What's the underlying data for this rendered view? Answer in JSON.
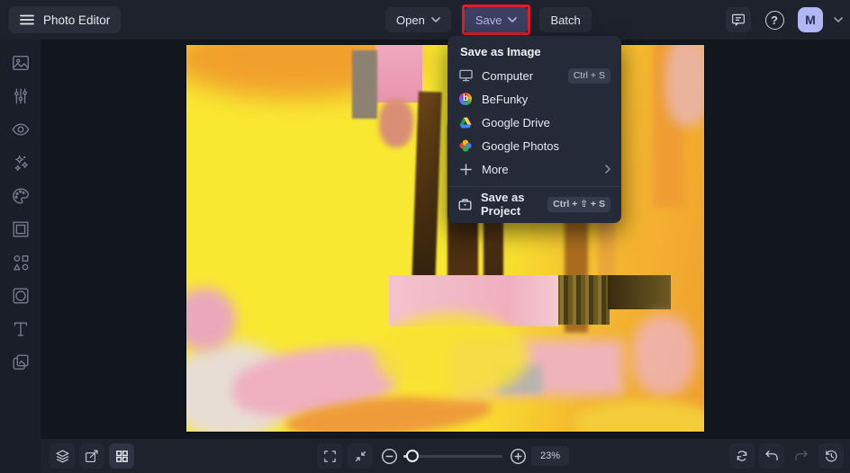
{
  "app": {
    "title": "Photo Editor"
  },
  "topbar": {
    "open": "Open",
    "save": "Save",
    "batch": "Batch",
    "help_glyph": "?",
    "avatar_initial": "M"
  },
  "save_menu": {
    "header": "Save as Image",
    "items": [
      {
        "label": "Computer",
        "shortcut": "Ctrl + S"
      },
      {
        "label": "BeFunky",
        "logo_letter": "b"
      },
      {
        "label": "Google Drive"
      },
      {
        "label": "Google Photos"
      },
      {
        "label": "More",
        "has_submenu": true
      }
    ],
    "project_item": {
      "label": "Save as Project",
      "shortcut": "Ctrl + ⇧ + S"
    }
  },
  "sidebar": {
    "tools": [
      "edit",
      "adjust",
      "touch-up",
      "effects",
      "artsy",
      "frames",
      "graphics",
      "overlays",
      "text",
      "textures"
    ]
  },
  "bottombar": {
    "zoom_percent": "23%"
  },
  "canvas": {
    "description": "Abstract expressionist painting with bright yellow, pink, orange and dark brown brush strokes",
    "palette": [
      "#f9e832",
      "#ef9a2e",
      "#efafbf",
      "#5a3a16",
      "#e8ddd4"
    ]
  },
  "colors": {
    "topbar_bg": "#1e222d",
    "workspace_bg": "#12161f",
    "panel_bg": "#252a38",
    "save_button_bg": "#3c3f62",
    "save_button_text": "#b3b9ee",
    "annotation_red": "#e41b28",
    "avatar_bg": "#b2b6f2"
  }
}
